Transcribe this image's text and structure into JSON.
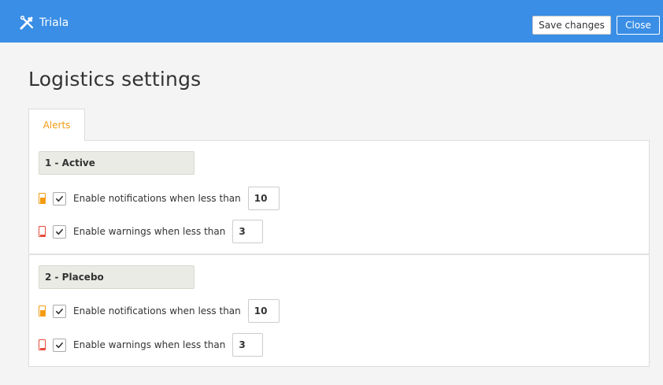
{
  "app": {
    "name": "Triala",
    "logo_icon": "tools-icon"
  },
  "toolbar": {
    "save_label": "Save changes",
    "close_label": "Close"
  },
  "page": {
    "title": "Logistics settings"
  },
  "tabs": [
    {
      "label": "Alerts",
      "active": true
    }
  ],
  "colors": {
    "accent": "#3a8ee6",
    "tab_active_text": "#f39c12",
    "notification_level": "#f39c12",
    "warning_level": "#e74c3c"
  },
  "groups": [
    {
      "name": "1 - Active",
      "notification": {
        "icon": "level-orange-icon",
        "checked": true,
        "label": "Enable notifications when less than",
        "value": "10"
      },
      "warning": {
        "icon": "level-red-icon",
        "checked": true,
        "label": "Enable warnings when less than",
        "value": "3"
      }
    },
    {
      "name": "2 - Placebo",
      "notification": {
        "icon": "level-orange-icon",
        "checked": true,
        "label": "Enable notifications when less than",
        "value": "10"
      },
      "warning": {
        "icon": "level-red-icon",
        "checked": true,
        "label": "Enable warnings when less than",
        "value": "3"
      }
    }
  ]
}
